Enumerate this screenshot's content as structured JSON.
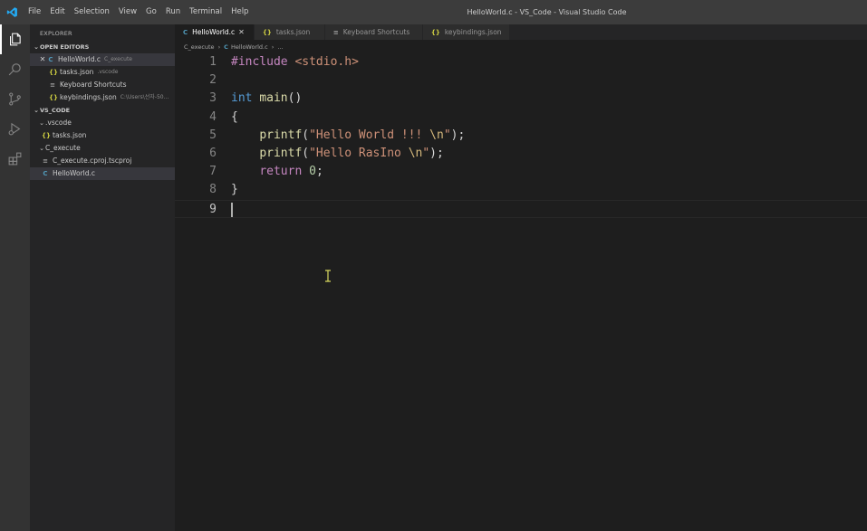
{
  "window": {
    "title": "HelloWorld.c - VS_Code - Visual Studio Code",
    "menu": [
      "File",
      "Edit",
      "Selection",
      "View",
      "Go",
      "Run",
      "Terminal",
      "Help"
    ]
  },
  "activity_bar": {
    "icons": [
      "explorer-icon",
      "search-icon",
      "source-control-icon",
      "run-debug-icon",
      "extensions-icon"
    ]
  },
  "sidebar": {
    "title": "EXPLORER",
    "open_editors": {
      "label": "OPEN EDITORS",
      "items": [
        {
          "name": "HelloWorld.c",
          "desc": "C_execute",
          "icon": "C"
        },
        {
          "name": "tasks.json",
          "desc": ".vscode",
          "icon": "{}"
        },
        {
          "name": "Keyboard Shortcuts",
          "desc": "",
          "icon": "≡"
        },
        {
          "name": "keybindings.json",
          "desc": "C:\\Users\\선자-50...",
          "icon": "{}"
        }
      ]
    },
    "workspace": {
      "label": "VS_CODE",
      "items": [
        {
          "name": ".vscode",
          "type": "folder"
        },
        {
          "name": "tasks.json",
          "type": "json",
          "icon": "{}"
        },
        {
          "name": "C_execute",
          "type": "folder"
        },
        {
          "name": "C_execute.cproj.tscproj",
          "type": "proj",
          "icon": "≡"
        },
        {
          "name": "HelloWorld.c",
          "type": "c",
          "icon": "C"
        }
      ]
    }
  },
  "tabs": [
    {
      "label": "HelloWorld.c",
      "icon": "C"
    },
    {
      "label": "tasks.json",
      "icon": "{}"
    },
    {
      "label": "Keyboard Shortcuts",
      "icon": "≡"
    },
    {
      "label": "keybindings.json",
      "icon": "{}"
    }
  ],
  "breadcrumb": {
    "folder": "C_execute",
    "file": "HelloWorld.c",
    "more": "..."
  },
  "editor": {
    "line_numbers": [
      "1",
      "2",
      "3",
      "4",
      "5",
      "6",
      "7",
      "8",
      "9"
    ],
    "l1": {
      "directive": "#include",
      "header": "<stdio.h>"
    },
    "l3": {
      "type": "int",
      "func": "main",
      "parens": "()"
    },
    "l4": "{",
    "l5": {
      "func": "printf",
      "open": "(",
      "str": "\"Hello World !!! ",
      "esc": "\\n",
      "strend": "\"",
      "close": ");"
    },
    "l6": {
      "func": "printf",
      "open": "(",
      "str": "\"Hello RasIno ",
      "esc": "\\n",
      "strend": "\"",
      "close": ");"
    },
    "l7": {
      "kw": "return",
      "num": "0",
      "end": ";"
    },
    "l8": "}"
  },
  "colors": {
    "accent": "#007acc",
    "c_icon": "#519aba",
    "json_icon": "#cbcb41"
  }
}
